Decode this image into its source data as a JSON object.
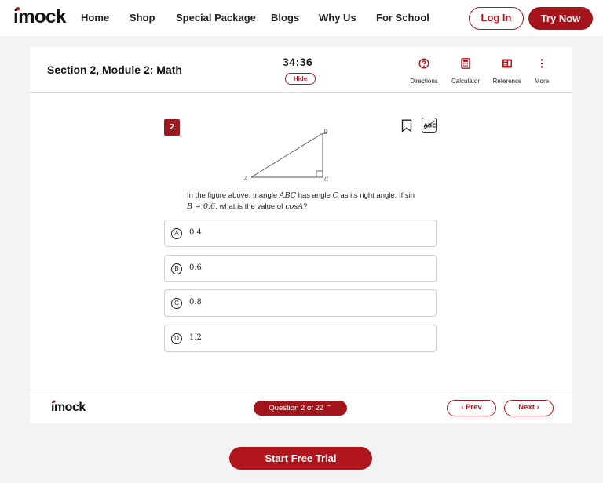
{
  "nav": {
    "logo": {
      "text": "imock"
    },
    "links": [
      "Home",
      "Shop",
      "Special Package",
      "Blogs",
      "Why Us",
      "For School"
    ],
    "login_label": "Log In",
    "try_label": "Try Now"
  },
  "exam": {
    "section_title": "Section 2, Module 2: Math",
    "timer": "34:36",
    "hide_label": "Hide",
    "tools": [
      {
        "label": "Directions",
        "icon": "question-circle-icon"
      },
      {
        "label": "Calculator",
        "icon": "calculator-icon"
      },
      {
        "label": "Reference",
        "icon": "reference-icon"
      },
      {
        "label": "More",
        "icon": "more-vertical-icon"
      }
    ]
  },
  "question": {
    "number": "2",
    "figure": {
      "labels": {
        "a": "A",
        "b": "B",
        "c": "C"
      }
    },
    "text": {
      "t1": "In the figure above, triangle ",
      "abc": "ABC",
      "t2": " has angle ",
      "c": "C",
      "t3": " as its right angle. If sin ",
      "b": "B = 0.6",
      "t4": ", what is the value of ",
      "cos": "cosA",
      "t5": "?"
    },
    "choices": [
      {
        "letter": "A",
        "value": "0.4"
      },
      {
        "letter": "B",
        "value": "0.6"
      },
      {
        "letter": "C",
        "value": "0.8"
      },
      {
        "letter": "D",
        "value": "1.2"
      }
    ]
  },
  "footer": {
    "logo": "imock",
    "question_progress": "Question 2 of 22",
    "prev_label": "Prev",
    "next_label": "Next"
  },
  "cta_label": "Start Free Trial",
  "colors": {
    "accent": "#a3141b",
    "accent_light": "#b5121b",
    "background": "#f3f3f3"
  }
}
